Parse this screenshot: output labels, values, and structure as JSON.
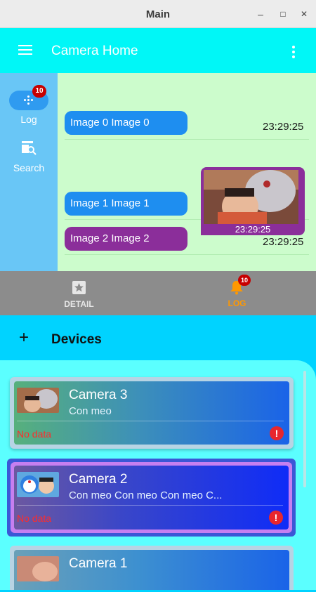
{
  "window": {
    "title": "Main",
    "minimize": "–",
    "maximize": "□",
    "close": "✕"
  },
  "appbar": {
    "title": "Camera Home",
    "menu_icon": "hamburger-icon",
    "more_icon": "more-vertical-icon"
  },
  "rail": {
    "items": [
      {
        "label": "Log",
        "icon": "apps-dots-icon",
        "badge": "10",
        "selected": true
      },
      {
        "label": "Search",
        "icon": "image-search-icon"
      }
    ]
  },
  "chat": {
    "messages": [
      {
        "text": "Image 0 Image 0",
        "time": "23:29:25",
        "color": "#1e8ef0"
      },
      {
        "text": "Image 1 Image 1",
        "color": "#1e8ef0"
      },
      {
        "text": "Image 2 Image 2",
        "time": "23:29:25",
        "color": "#8b2e9a"
      }
    ],
    "image_message": {
      "time": "23:29:25"
    }
  },
  "bottom_nav": {
    "items": [
      {
        "label": "DETAIL",
        "icon": "star-box-icon",
        "color": "#e6e6e6"
      },
      {
        "label": "LOG",
        "icon": "bell-icon",
        "badge": "10",
        "color": "#ff9800"
      }
    ]
  },
  "devices": {
    "title": "Devices",
    "add_icon": "plus-icon",
    "cards": [
      {
        "name": "Camera 3",
        "description": "Con meo",
        "status": "No data"
      },
      {
        "name": "Camera 2",
        "description": "Con meo Con meo Con meo C...",
        "status": "No data",
        "selected": true
      },
      {
        "name": "Camera 1"
      }
    ]
  }
}
